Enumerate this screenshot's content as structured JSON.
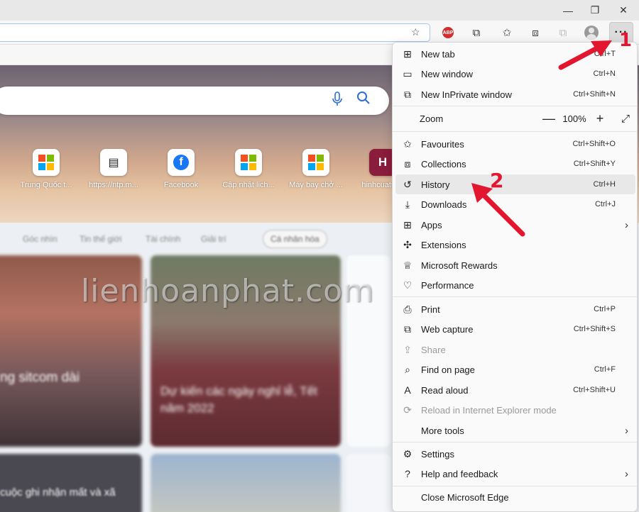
{
  "menu": {
    "items": [
      {
        "label": "New tab",
        "shortcut": "Ctrl+T",
        "icon": "new-tab-icon"
      },
      {
        "label": "New window",
        "shortcut": "Ctrl+N",
        "icon": "new-window-icon"
      },
      {
        "label": "New InPrivate window",
        "shortcut": "Ctrl+Shift+N",
        "icon": "inprivate-icon"
      },
      {
        "label": "Favourites",
        "shortcut": "Ctrl+Shift+O",
        "icon": "star-list-icon"
      },
      {
        "label": "Collections",
        "shortcut": "Ctrl+Shift+Y",
        "icon": "collections-icon"
      },
      {
        "label": "History",
        "shortcut": "Ctrl+H",
        "icon": "history-icon"
      },
      {
        "label": "Downloads",
        "shortcut": "Ctrl+J",
        "icon": "download-icon"
      },
      {
        "label": "Apps",
        "shortcut": "",
        "icon": "apps-icon"
      },
      {
        "label": "Extensions",
        "shortcut": "",
        "icon": "puzzle-icon"
      },
      {
        "label": "Microsoft Rewards",
        "shortcut": "",
        "icon": "rewards-icon"
      },
      {
        "label": "Performance",
        "shortcut": "",
        "icon": "heartbeat-icon"
      },
      {
        "label": "Print",
        "shortcut": "Ctrl+P",
        "icon": "print-icon"
      },
      {
        "label": "Web capture",
        "shortcut": "Ctrl+Shift+S",
        "icon": "web-capture-icon"
      },
      {
        "label": "Share",
        "shortcut": "",
        "icon": "share-icon"
      },
      {
        "label": "Find on page",
        "shortcut": "Ctrl+F",
        "icon": "find-icon"
      },
      {
        "label": "Read aloud",
        "shortcut": "Ctrl+Shift+U",
        "icon": "read-aloud-icon"
      },
      {
        "label": "Reload in Internet Explorer mode",
        "shortcut": "",
        "icon": "ie-mode-icon"
      },
      {
        "label": "More tools",
        "shortcut": "",
        "icon": ""
      },
      {
        "label": "Settings",
        "shortcut": "",
        "icon": "gear-icon"
      },
      {
        "label": "Help and feedback",
        "shortcut": "",
        "icon": "help-icon"
      },
      {
        "label": "Close Microsoft Edge",
        "shortcut": "",
        "icon": ""
      }
    ],
    "zoom": {
      "label": "Zoom",
      "value": "100%",
      "minus": "—",
      "plus": "+",
      "fullscreen": "⤢"
    }
  },
  "toolbar": {
    "more_label": "···",
    "abp_label": "ABP"
  },
  "window": {
    "minimize": "—",
    "restore": "❐",
    "close": "✕"
  },
  "tiles": [
    {
      "label": "Trung Quốc t...",
      "icon": "microsoft-logo"
    },
    {
      "label": "https://ntp.m...",
      "icon": "calendar-app-icon"
    },
    {
      "label": "Facebook",
      "icon": "facebook-icon"
    },
    {
      "label": "Cập nhật lịch...",
      "icon": "microsoft-logo"
    },
    {
      "label": "Máy bay chở ...",
      "icon": "microsoft-logo"
    },
    {
      "label": "hinhcuatui...",
      "icon": "h-letter-icon"
    }
  ],
  "feed": {
    "nav": [
      "Góc nhìn",
      "Tin thế giới",
      "Tài chính",
      "Giải trí"
    ],
    "personalize": "Cá nhân hóa",
    "card1_title": "ng sitcom dài",
    "card2_title": "Dự kiến các ngày nghỉ lễ, Tết năm 2022",
    "card4_title": "cuộc ghi nhận mất và xã"
  },
  "watermark": "lienhoanphat.com",
  "annotations": {
    "step1": "1",
    "step2": "2"
  },
  "colors": {
    "accent": "#2a6fd6",
    "annotation": "#e2172f",
    "menu_bg": "#fafafa"
  }
}
